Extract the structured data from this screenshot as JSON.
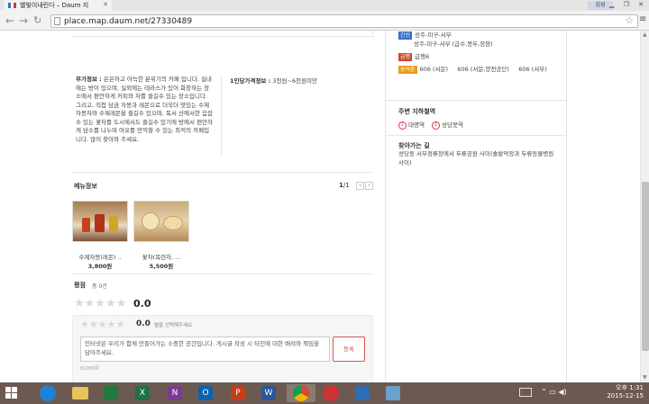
{
  "browser": {
    "tab_title": "별빛이내린다 – Daum 지",
    "user_label": "김성",
    "address": "place.map.daum.net/27330489"
  },
  "info": {
    "left_label": "부가정보 :",
    "left_text": "은은하고 아늑한 분위기의 카페 입니다. 실내에는 방이 있으며, 실외에는 테라스가 있어 화창하는 장소에서 편안하게 커피와 차를 즐길수 있는 장소입니다. 그리고, 직접 담금 자몽과 레몬으로 더욱더 맛있는 수제자몽차와 수제레몬을 즐길수 있으며, 독서 산에서한 음잡수 있는 꽃차를 도시에서도 즐길수 있기에 방에서 편안하게 담소를 나누며 여유를 만끽할 수 있는 최적의 카페입니다. 많이 찾아와 주세요.",
    "right_label": "1인당가격정보 :",
    "right_text": "3천원~6천원미만"
  },
  "menu": {
    "title": "메뉴정보",
    "page_current": "1",
    "page_total": "/1",
    "prev": "‹",
    "next": "›",
    "items": [
      {
        "name": "수제자몽(레몬) ..",
        "price": "3,800원"
      },
      {
        "name": "꽃차(목련차, ...",
        "price": "5,500원"
      }
    ]
  },
  "rating": {
    "title": "평점",
    "count_label": "총 0건",
    "stars": "★★★★★",
    "score": "0.0",
    "user_score": "0.0",
    "user_hint": "별을 선택해주세요",
    "comment_placeholder": "인터넷은 우리가 함께 만들어가는 소중한 공간입니다. 게시글 작성 시 타인에 대한 배려와 책임을 담아주세요.",
    "submit": "등록",
    "char_count": "0/200자"
  },
  "side": {
    "bus_rows": [
      {
        "badge": "간선",
        "badge_color": "#3a6ec8",
        "text": "성주-미구-서부"
      },
      {
        "badge": "",
        "badge_color": "",
        "text": "성주-미구-서부 (급수,봉두,장판)"
      },
      {
        "badge": "급행",
        "badge_color": "#d0452e",
        "text": "급행6"
      },
      {
        "badge": "농어촌",
        "badge_color": "#e89c1c",
        "text": "606 (서문)     606 (서문,양전공단)     606 (서부)"
      }
    ],
    "subway_title": "주변 지하철역",
    "subway_items": [
      "대명역",
      "성당못역"
    ],
    "route_title": "찾아가는 길",
    "route_text": "성당동 서부정류장에서 두류공원 사이(솔밭악장과 두류동물병원 사이)"
  },
  "tray": {
    "time": "오후 1:31",
    "date": "2015-12-15"
  },
  "colors": {
    "taskbar": "#6c5a50",
    "submit_border": "#d45555"
  }
}
